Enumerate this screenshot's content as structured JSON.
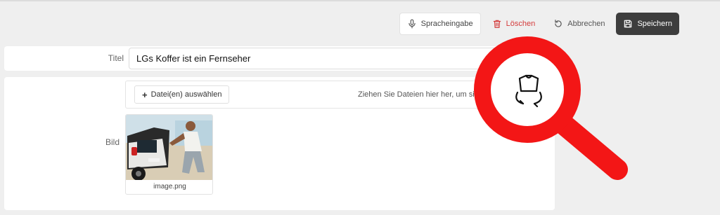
{
  "toolbar": {
    "voice_label": "Spracheingabe",
    "delete_label": "Löschen",
    "cancel_label": "Abbrechen",
    "save_label": "Speichern"
  },
  "form": {
    "title_label": "Titel",
    "title_value": "LGs Koffer ist ein Fernseher",
    "image_label": "Bild",
    "choose_files_label": "Datei(en) auswählen",
    "drop_hint": "Ziehen Sie Dateien hier her, um sie hochzuladen",
    "file_name": "image.png"
  },
  "icons": {
    "voice": "microphone-icon",
    "delete": "trash-icon",
    "cancel": "undo-icon",
    "save": "floppy-disk-icon",
    "overlay": "magnifier-icon",
    "rotate": "rotate-shirt-icon"
  },
  "colors": {
    "delete_red": "#d43b3b",
    "save_bg": "#3d3d3d",
    "magnifier_red": "#f31616"
  }
}
